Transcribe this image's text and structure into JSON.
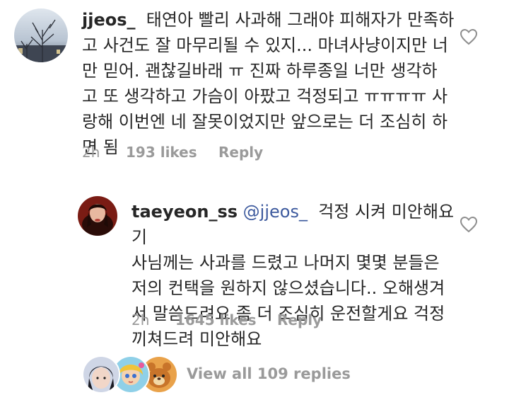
{
  "comment": {
    "username": "jjeos_",
    "text": "태연아 빨리 사과해 그래야 피해자가 만족하고 사건도 잘 마무리될 수 있지... 마녀사냥이지만 너만 믿어. 괜찮길바래 ㅠ 진짜 하루종일 너만 생각하고 또 생각하고 가슴이 아팠고 걱정되고 ㅠㅠㅠㅠ 사랑해 이번엔 네 잘못이었지만 앞으로는 더 조심히 하면 됨",
    "lines": [
      "태연아 빨리 사과해 그래야 피해자가 만족하",
      "고 사건도 잘 마무리될 수 있지... 마녀사냥이지만 너",
      "만 믿어. 괜찮길바래 ㅠ 진짜 하루종일 너만 생각하",
      "고 또 생각하고 가슴이 아팠고 걱정되고 ㅠㅠㅠㅠ 사",
      "랑해 이번엔 네 잘못이었지만 앞으로는 더 조심히 하",
      "면 됨"
    ],
    "time": "2h",
    "likes": "193 likes",
    "reply_label": "Reply"
  },
  "reply": {
    "username": "taeyeon_ss",
    "mention": "@jjeos_",
    "lines": [
      "걱정 시켜 미안해요 기",
      "사님께는 사과를 드렸고 나머지 몇몇 분들은",
      "저의 컨택을 원하지 않으셨습니다.. 오해생겨",
      "서 말씀드려요 좀 더 조심히 운전할게요 걱정",
      "끼쳐드려 미안해요"
    ],
    "time": "2h",
    "likes": "1645 likes",
    "reply_label": "Reply"
  },
  "view_replies_label": "View all 109 replies",
  "colors": {
    "text": "#262626",
    "meta": "#9a9a9a",
    "mention": "#3d5a9e"
  }
}
